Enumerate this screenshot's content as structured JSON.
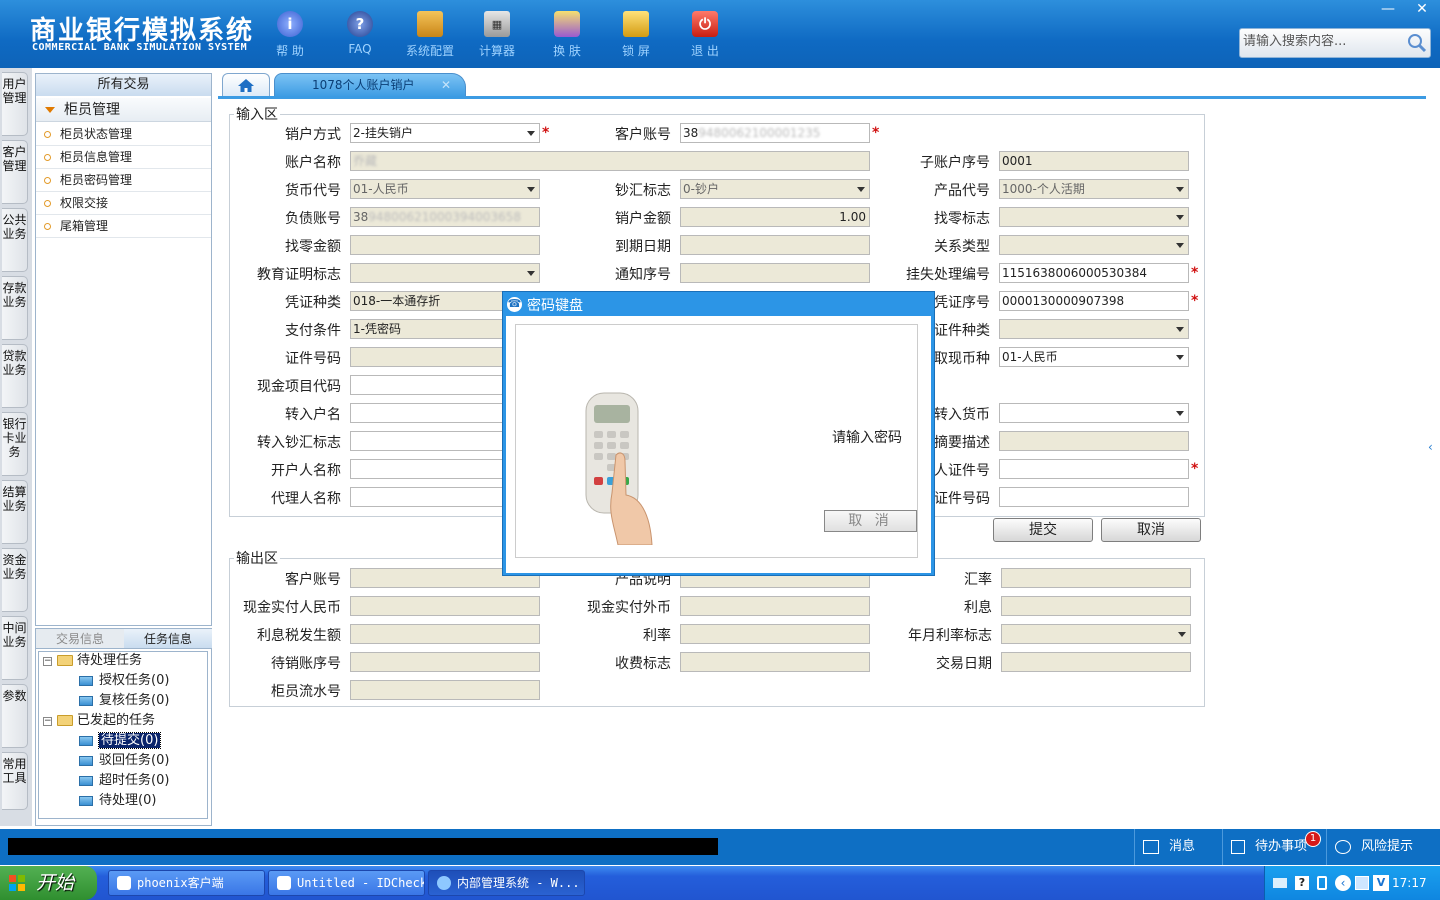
{
  "app": {
    "title": "商业银行模拟系统",
    "subtitle": "COMMERCIAL BANK SIMULATION SYSTEM",
    "minimize": "—",
    "close": "✕"
  },
  "toolbar": {
    "help": "帮 助",
    "faq": "FAQ",
    "config": "系统配置",
    "calculator": "计算器",
    "skin": "换 肤",
    "lock": "锁 屏",
    "exit": "退 出"
  },
  "search": {
    "placeholder": "请输入搜索内容..."
  },
  "vtabs": [
    "用户管理",
    "客户管理",
    "公共业务",
    "存款业务",
    "贷款业务",
    "银行卡业务",
    "结算业务",
    "资金业务",
    "中间业务",
    "参数",
    "常用工具"
  ],
  "nav": {
    "header": "所有交易",
    "group": "柜员管理",
    "items": [
      "柜员状态管理",
      "柜员信息管理",
      "柜员密码管理",
      "权限交接",
      "尾箱管理"
    ]
  },
  "task_panel": {
    "tabs": [
      "交易信息",
      "任务信息"
    ],
    "pending": "待处理任务",
    "auth": "授权任务(0)",
    "review": "复核任务(0)",
    "initiated": "已发起的任务",
    "to_submit": "待提交(0)",
    "rejected": "驳回任务(0)",
    "timeout": "超时任务(0)",
    "to_process": "待处理(0)"
  },
  "tabs": {
    "active": "1078个人账户销户",
    "close": "✕"
  },
  "input": {
    "legend": "输入区",
    "labels": {
      "close_method": "销户方式",
      "cust_account": "客户账号",
      "account_name": "账户名称",
      "sub_seq": "子账户序号",
      "currency_code": "货币代号",
      "cash_flag": "钞汇标志",
      "product_code": "产品代号",
      "debt_account": "负债账号",
      "close_amount": "销户金额",
      "change_flag": "找零标志",
      "change_amount": "找零金额",
      "due_date": "到期日期",
      "relation_type": "关系类型",
      "edu_flag": "教育证明标志",
      "notice_seq": "通知序号",
      "loss_no": "挂失处理编号",
      "voucher_type": "凭证种类",
      "voucher_no": "凭证序号",
      "pay_cond": "支付条件",
      "id_type": "证件种类",
      "id_no": "证件号码",
      "withdraw_ccy": "取现币种",
      "cash_item": "现金项目代码",
      "to_name": "转入户名",
      "to_ccy": "转入货币",
      "to_cash_flag": "转入钞汇标志",
      "summary": "摘要描述",
      "opener_name": "开户人名称",
      "person_id": "人证件号",
      "agent_name": "代理人名称",
      "agent_id": "证件号码"
    },
    "values": {
      "close_method": "2-挂失销户",
      "cust_account": "38",
      "cust_account_hidden": "9480062100001235",
      "account_name_hidden": "乔藏",
      "sub_seq": "0001",
      "currency_code": "01-人民币",
      "cash_flag": "0-钞户",
      "product_code": "1000-个人活期",
      "debt_account": "38",
      "debt_account_hidden": "94800621000394003658",
      "close_amount": "1.00",
      "loss_no": "1151638006000530384",
      "voucher_type": "018-一本通存折",
      "voucher_no": "0000130000907398",
      "pay_cond": "1-凭密码",
      "withdraw_ccy": "01-人民币"
    },
    "required_mark": "*"
  },
  "buttons": {
    "submit": "提交",
    "cancel": "取消"
  },
  "output": {
    "legend": "输出区",
    "labels": {
      "cust_account": "客户账号",
      "product_desc": "产品说明",
      "rate": "汇率",
      "cash_cny": "现金实付人民币",
      "cash_fx": "现金实付外币",
      "interest": "利息",
      "interest_tax": "利息税发生额",
      "int_rate": "利率",
      "rate_flag": "年月利率标志",
      "pending_seq": "待销账序号",
      "fee_flag": "收费标志",
      "trade_date": "交易日期",
      "teller_seq": "柜员流水号"
    }
  },
  "dialog": {
    "title": "密码键盘",
    "message": "请输入密码",
    "cancel": "取 消"
  },
  "statusbar": {
    "message": "消息",
    "todo": "待办事项",
    "todo_count": "1",
    "risk": "风险提示"
  },
  "taskbar": {
    "start": "开始",
    "tasks": [
      "phoenix客户端",
      "Untitled - IDCheck",
      "内部管理系统 - W..."
    ],
    "clock": "17:17"
  }
}
